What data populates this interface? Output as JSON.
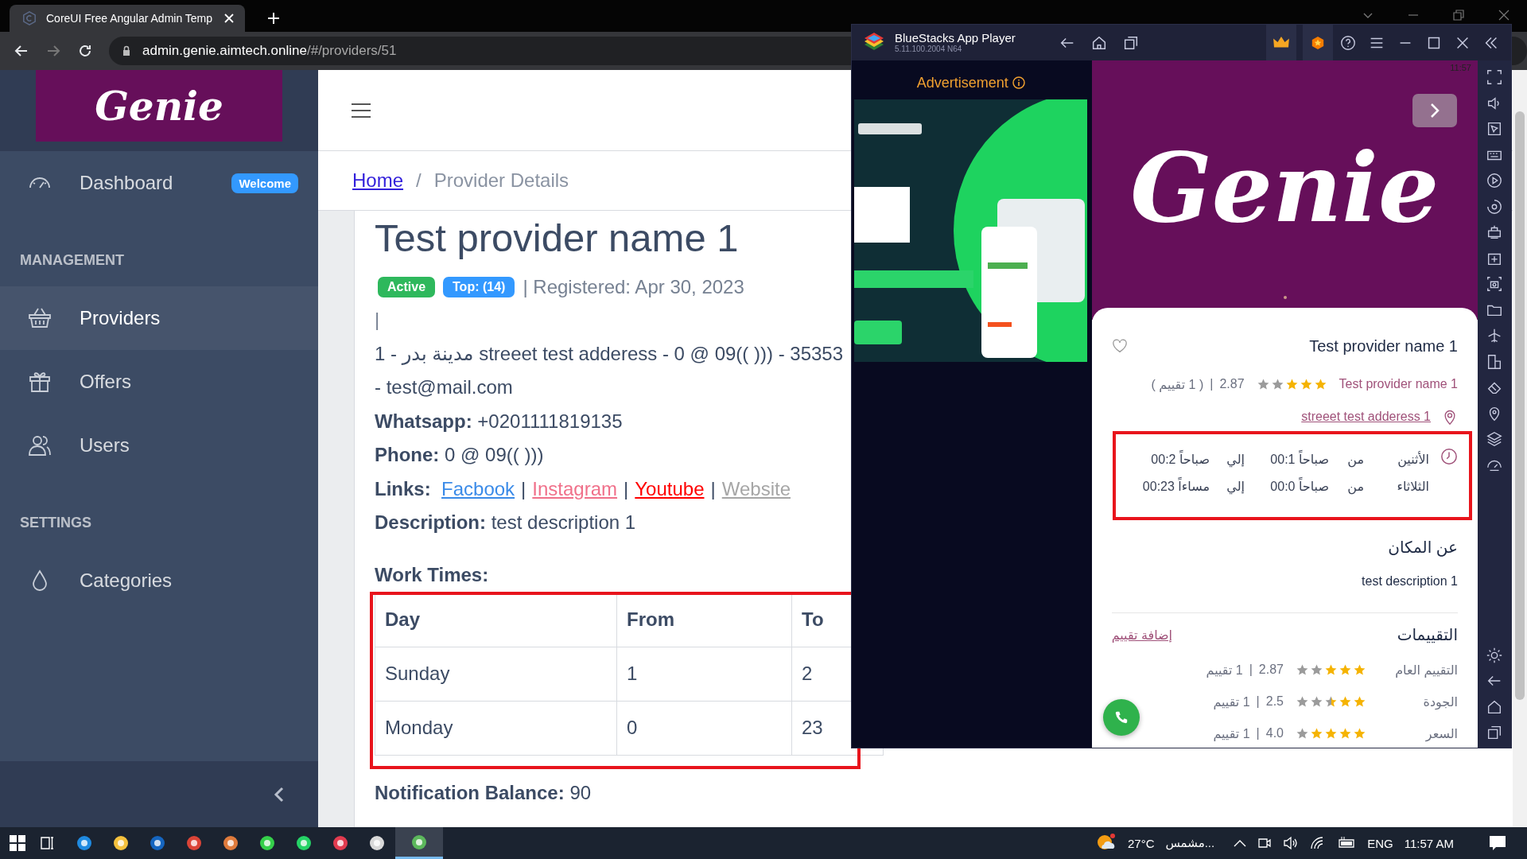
{
  "browser": {
    "tab": {
      "title": "CoreUI Free Angular Admin Temp"
    },
    "address": {
      "host": "admin.genie.aimtech.online",
      "path": "/#/providers/51"
    }
  },
  "sidebar": {
    "logo": "Genie",
    "items": [
      {
        "kind": "link",
        "label": "Dashboard",
        "badge": "Welcome",
        "selected": false
      },
      {
        "kind": "heading",
        "label": "MANAGEMENT"
      },
      {
        "kind": "link",
        "label": "Providers",
        "selected": true
      },
      {
        "kind": "link",
        "label": "Offers",
        "selected": false
      },
      {
        "kind": "link",
        "label": "Users",
        "selected": false
      },
      {
        "kind": "heading",
        "label": "SETTINGS"
      },
      {
        "kind": "link",
        "label": "Categories",
        "selected": false
      }
    ]
  },
  "breadcrumb": [
    {
      "kind": "link",
      "label": "Home"
    },
    {
      "kind": "separator",
      "label": "/"
    },
    {
      "kind": "current",
      "label": "Provider Details"
    }
  ],
  "provider": {
    "title": "Test provider name 1",
    "badges": [
      {
        "label": "Active",
        "color": "#2eb85c"
      },
      {
        "label": "Top: (14)",
        "color": "#3399ff"
      }
    ],
    "registered": "| Registered: Apr 30, 2023",
    "bar": "|",
    "address": "1 - مدينة بدر streeet test adderess - 0 @ 09(( ))) - 35353",
    "email": "- test@mail.com",
    "fields": [
      {
        "label": "Whatsapp:",
        "value": "+0201111819135"
      },
      {
        "label": "Phone:",
        "value": "0 @ 09(( )))"
      }
    ],
    "links_label": "Links:",
    "links": [
      {
        "kind": "link",
        "label": "Facbook",
        "color": "#3b8be8"
      },
      {
        "kind": "separator",
        "label": "|"
      },
      {
        "kind": "link",
        "label": "Instagram",
        "color": "#f0708a"
      },
      {
        "kind": "separator",
        "label": "|"
      },
      {
        "kind": "link",
        "label": "Youtube",
        "color": "#ff0000"
      },
      {
        "kind": "separator",
        "label": "|"
      },
      {
        "kind": "link",
        "label": "Website",
        "color": "#a6a6a6"
      }
    ],
    "description": {
      "label": "Description:",
      "value": "test description 1"
    },
    "work_times": {
      "title": "Work Times:",
      "columns": [
        "Day",
        "From",
        "To"
      ],
      "rows": [
        [
          "Sunday",
          "1",
          "2"
        ],
        [
          "Monday",
          "0",
          "23"
        ]
      ]
    },
    "notification": {
      "label": "Notification Balance:",
      "value": "90"
    }
  },
  "bluestacks": {
    "title": "BlueStacks App Player",
    "version": "5.11.100.2004  N64",
    "ad_label": "Advertisement",
    "app": {
      "time": "11:57",
      "logo": "Genie",
      "name": "Test provider name 1",
      "subtitle": "Test provider name 1",
      "rating": {
        "stars": 3,
        "score": "2.87",
        "separator": "|",
        "count": "( 1 تقييم )"
      },
      "address": "streeet test adderess 1",
      "hours": [
        {
          "day": "الأثنين",
          "from_word": "من",
          "from": "00:1 صباحاً",
          "to_word": "إلي",
          "to": "00:2 صباحاً"
        },
        {
          "day": "الثلاثاء",
          "from_word": "من",
          "from": "00:0 صباحاً",
          "to_word": "إلي",
          "to": "00:23 مساءاً"
        }
      ],
      "about_title": "عن المكان",
      "about": "test description 1",
      "reviews_title": "التقييمات",
      "add_review": "إضافة تقييم",
      "ratings": [
        {
          "label": "التقييم العام",
          "stars": 3,
          "score": "2.87",
          "separator": "|",
          "count": "1 تقييم"
        },
        {
          "label": "الجودة",
          "stars": 2.5,
          "score": "2.5",
          "separator": "|",
          "count": "1 تقييم"
        },
        {
          "label": "السعر",
          "stars": 4,
          "score": "4.0",
          "separator": "|",
          "count": "1 تقييم"
        }
      ]
    }
  },
  "taskbar": {
    "apps": [
      {
        "selected": false
      },
      {
        "selected": false
      },
      {
        "selected": false
      },
      {
        "selected": false
      },
      {
        "selected": false
      },
      {
        "selected": false
      },
      {
        "selected": false
      },
      {
        "selected": false
      },
      {
        "selected": false
      },
      {
        "selected": true
      }
    ],
    "temperature": "27°C",
    "weather": "مشمس...",
    "language": "ENG",
    "time": "11:57 AM"
  }
}
